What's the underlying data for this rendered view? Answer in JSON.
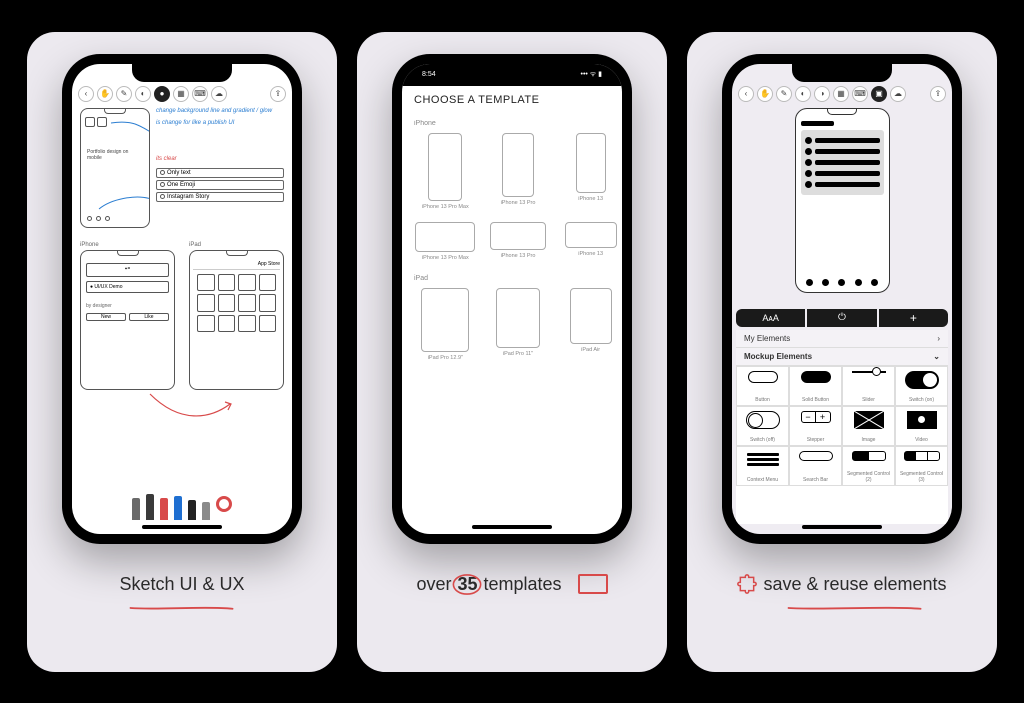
{
  "captions": {
    "c1": "Sketch UI & UX",
    "c2_pre": "over ",
    "c2_num": "35",
    "c2_post": " templates",
    "c3": "save & reuse elements"
  },
  "card1": {
    "note1": "change background line and gradient / glow",
    "note2": "is change for like a publish UI",
    "note3": "its clear",
    "labelSmall1": "Born",
    "list1": "Only text",
    "list2": "One Emoji",
    "list3": "Instagram Story",
    "miniTitle1": "Portfolio design on mobile",
    "labelA": "iPhone",
    "labelB": "iPad",
    "uiux_name": "UI/UX Demo",
    "by": "by designer",
    "newLabel": "New",
    "likeLabel": "Like",
    "pens": [
      "#6a6a6a",
      "#3a3a3a",
      "#d84a4a",
      "#1f6fd1",
      "#222",
      "#8a8a8a",
      "#d84a4a"
    ]
  },
  "card2": {
    "time": "8:54",
    "title": "CHOOSE A TEMPLATE",
    "section1": "iPhone",
    "section2": "iPad",
    "row1": [
      "iPhone 13 Pro Max",
      "iPhone 13 Pro",
      "iPhone 13"
    ],
    "row2": [
      "iPhone 13 Pro Max",
      "iPhone 13 Pro",
      "iPhone 13"
    ],
    "row3": [
      "iPad Pro 12.9\"",
      "iPad Pro 11\"",
      "iPad Air"
    ]
  },
  "card3": {
    "tabs": [
      "text-icon",
      "export-icon",
      "plus-icon"
    ],
    "panel1": "My Elements",
    "panel2": "Mockup Elements",
    "elements_r1": [
      "Button",
      "Solid Button",
      "Slider",
      "Switch (on)"
    ],
    "elements_r2": [
      "Switch (off)",
      "Stepper",
      "Image",
      "Video"
    ],
    "elements_r3": [
      "Context Menu",
      "Search Bar",
      "Segmented Control (2)",
      "Segmented Control (3)"
    ],
    "stepper_minus": "−",
    "stepper_plus": "+"
  }
}
